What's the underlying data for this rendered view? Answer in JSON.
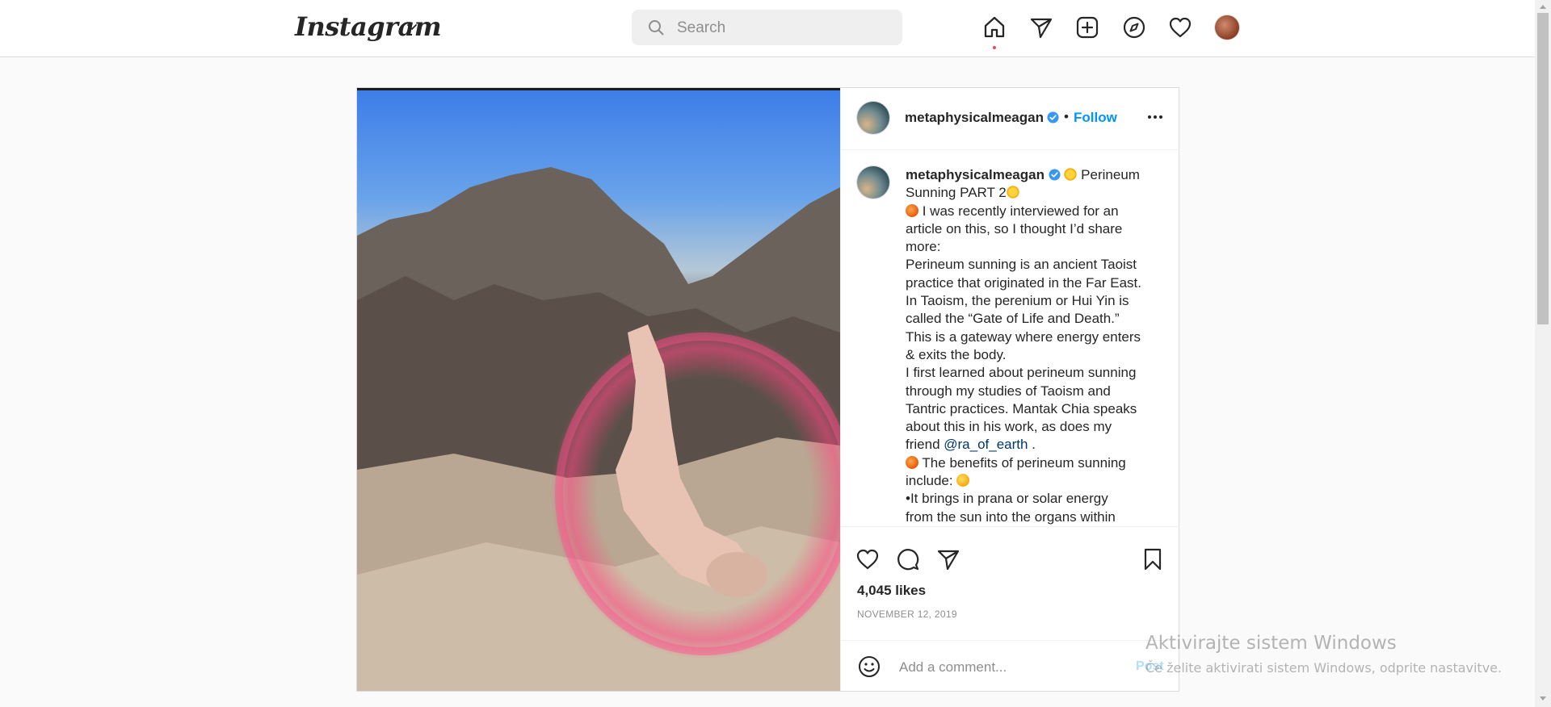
{
  "brand": {
    "name": "Instagram"
  },
  "search": {
    "placeholder": "Search"
  },
  "post": {
    "username": "metaphysicalmeagan",
    "follow_label": "Follow",
    "separator": "•",
    "caption_lines": [
      [
        "",
        "Perineum"
      ],
      [
        "Sunning PART 2",
        ""
      ],
      [
        "I was recently interviewed for an"
      ],
      [
        "article on this, so I thought I’d share"
      ],
      [
        "more:"
      ],
      [
        "Perineum sunning is an ancient Taoist"
      ],
      [
        "practice that originated in the Far East."
      ],
      [
        "In Taoism, the perenium or Hui Yin is"
      ],
      [
        "called the “Gate of Life and Death.”"
      ],
      [
        "This is a gateway where energy enters"
      ],
      [
        "& exits the body."
      ],
      [
        "I first learned about perineum sunning"
      ],
      [
        "through my studies of Taoism and"
      ],
      [
        "Tantric practices. Mantak Chia speaks"
      ],
      [
        "about this in his work, as does my"
      ],
      [
        "friend"
      ],
      [
        "The benefits of perineum sunning"
      ],
      [
        "include:"
      ],
      [
        "•It brings in prana or solar energy"
      ],
      [
        "from the sun into the organs within"
      ]
    ],
    "caption": {
      "l1": "Perineum",
      "l2": "Sunning PART 2",
      "l3": "I was recently interviewed for an",
      "l4": "article on this, so I thought I’d share",
      "l5": "more:",
      "l6": "Perineum sunning is an ancient Taoist",
      "l7": "practice that originated in the Far East.",
      "l8": "In Taoism, the perenium or Hui Yin is",
      "l9": "called the “Gate of Life and Death.”",
      "l10": "This is a gateway where energy enters",
      "l11": "& exits the body.",
      "l12": "I first learned about perineum sunning",
      "l13": "through my studies of Taoism and",
      "l14": "Tantric practices. Mantak Chia speaks",
      "l15": "about this in his work, as does my",
      "l16": "friend",
      "mention": "@ra_of_earth",
      "l16_end": ".",
      "l17": "The benefits of perineum sunning",
      "l18": "include:",
      "l19": "•It brings in prana or solar energy",
      "l20": "from the sun into the organs within"
    },
    "likes": "4,045 likes",
    "date": "NOVEMBER 12, 2019",
    "comment_placeholder": "Add a comment...",
    "post_label": "Post"
  },
  "icons": {
    "home": "home-icon",
    "direct": "paper-plane-icon",
    "new_post": "plus-square-icon",
    "explore": "compass-icon",
    "activity": "heart-icon",
    "like": "heart-icon",
    "comment": "comment-icon",
    "share": "paper-plane-icon",
    "save": "bookmark-icon"
  },
  "colors": {
    "accent": "#0095f6",
    "notification_dot": "#ed4956",
    "mention": "#00376b"
  },
  "watermark": {
    "title": "Aktivirajte sistem Windows",
    "subtitle": "Če želite aktivirati sistem Windows, odprite nastavitve."
  }
}
